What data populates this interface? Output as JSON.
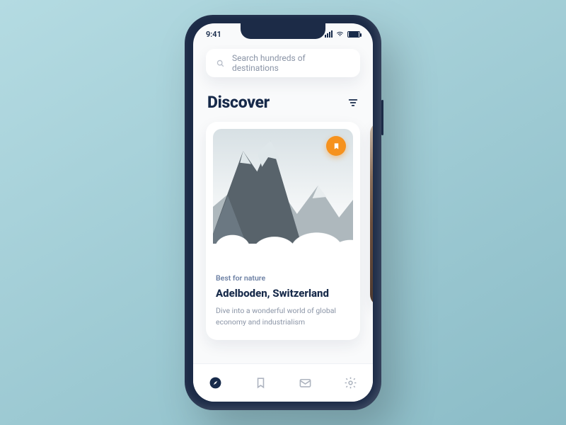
{
  "status": {
    "time": "9:41",
    "wifi_label": "wifi",
    "signal_label": "signal",
    "battery_label": "battery"
  },
  "search": {
    "placeholder": "Search hundreds of destinations",
    "icon": "search-icon"
  },
  "header": {
    "title": "Discover",
    "filter_label": "filter"
  },
  "card": {
    "bookmarked": true,
    "bookmark_icon": "bookmark-icon",
    "tag": "Best for nature",
    "title": "Adelboden, Switzerland",
    "description": "Dive into a wonderful world of global economy and industrialism"
  },
  "tabs": {
    "explore": "explore",
    "saved": "saved",
    "inbox": "inbox",
    "settings": "settings"
  },
  "colors": {
    "accent": "#f6921e",
    "text_dark": "#172a4a",
    "text_muted": "#8a94a6",
    "phone_shell": "#1c2b47"
  }
}
